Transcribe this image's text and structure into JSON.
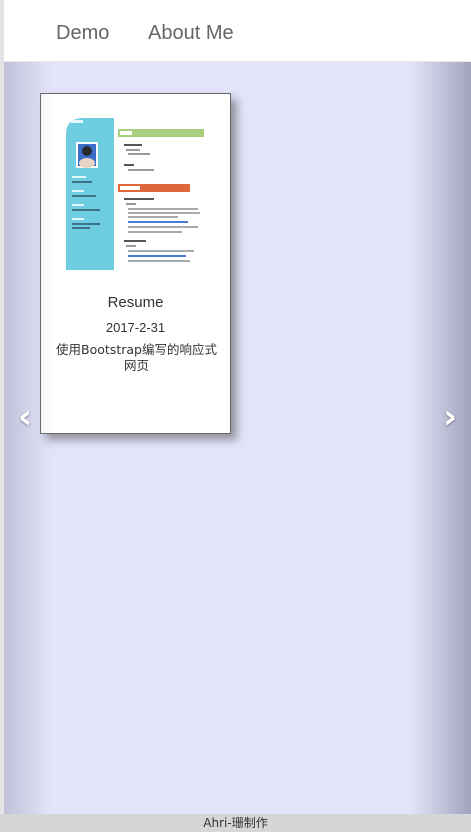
{
  "nav": {
    "items": [
      {
        "label": "Demo"
      },
      {
        "label": "About Me"
      }
    ]
  },
  "carousel": {
    "prev_icon": "chevron-left-icon",
    "next_icon": "chevron-right-icon",
    "card": {
      "title": "Resume",
      "date": "2017-2-31",
      "description": "使用Bootstrap编写的响应式网页"
    }
  },
  "footer": {
    "text": "Ahri-珊制作"
  },
  "colors": {
    "carousel_bg": "#e3e3f9",
    "resume_sidebar": "#6ecde0",
    "resume_green": "#a9cf7e",
    "resume_orange": "#e0673a"
  }
}
